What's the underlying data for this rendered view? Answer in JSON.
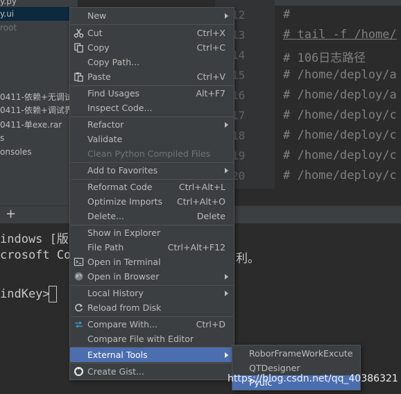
{
  "project_tree": {
    "rows": [
      {
        "text": "y.py"
      },
      {
        "text": "y.ui"
      },
      {
        "text": "root"
      },
      {
        "text": "0411-依赖+无调试"
      },
      {
        "text": "0411-依赖+调试界"
      },
      {
        "text": "0411-单exe.rar"
      },
      {
        "text": "s"
      },
      {
        "text": "onsoles"
      }
    ]
  },
  "editor": {
    "line_numbers": [
      "12",
      "13",
      "14",
      "15",
      "16",
      "17",
      "18",
      "19",
      "20"
    ],
    "lines": [
      "#",
      "# tail -f /home/",
      "# 106日志路径",
      "# /home/deploy/a",
      "# /home/deploy/a",
      "# /home/deploy/c",
      "# /home/deploy/c",
      "# /home/deploy/c",
      "# /home/deploy/c"
    ]
  },
  "terminal": {
    "plus": "+",
    "lines": [
      "indows [版",
      "crosoft Co",
      "利。",
      "indKey>"
    ]
  },
  "menu": {
    "items": [
      {
        "label": "New",
        "shortcut": "",
        "submenu": true
      },
      {
        "label": "Cut",
        "shortcut": "Ctrl+X",
        "icon": "scissors-icon"
      },
      {
        "label": "Copy",
        "shortcut": "Ctrl+C",
        "icon": "copy-icon"
      },
      {
        "label": "Copy Path...",
        "shortcut": ""
      },
      {
        "label": "Paste",
        "shortcut": "Ctrl+V",
        "icon": "paste-icon"
      },
      {
        "label": "Find Usages",
        "shortcut": "Alt+F7"
      },
      {
        "label": "Inspect Code...",
        "shortcut": ""
      },
      {
        "label": "Refactor",
        "shortcut": "",
        "submenu": true
      },
      {
        "label": "Validate",
        "shortcut": ""
      },
      {
        "label": "Clean Python Compiled Files",
        "shortcut": "",
        "disabled": true
      },
      {
        "label": "Add to Favorites",
        "shortcut": "",
        "submenu": true
      },
      {
        "label": "Reformat Code",
        "shortcut": "Ctrl+Alt+L"
      },
      {
        "label": "Optimize Imports",
        "shortcut": "Ctrl+Alt+O"
      },
      {
        "label": "Delete...",
        "shortcut": "Delete"
      },
      {
        "label": "Show in Explorer",
        "shortcut": ""
      },
      {
        "label": "File Path",
        "shortcut": "Ctrl+Alt+F12"
      },
      {
        "label": "Open in Terminal",
        "shortcut": "",
        "icon": "terminal-icon"
      },
      {
        "label": "Open in Browser",
        "shortcut": "",
        "icon": "globe-icon",
        "submenu": true
      },
      {
        "label": "Local History",
        "shortcut": "",
        "submenu": true
      },
      {
        "label": "Reload from Disk",
        "shortcut": "",
        "icon": "reload-icon"
      },
      {
        "label": "Compare With...",
        "shortcut": "Ctrl+D",
        "icon": "compare-icon"
      },
      {
        "label": "Compare File with Editor",
        "shortcut": ""
      },
      {
        "label": "External Tools",
        "shortcut": "",
        "submenu": true,
        "highlighted": true
      },
      {
        "label": "Create Gist...",
        "shortcut": "",
        "icon": "github-icon"
      }
    ]
  },
  "submenu": {
    "items": [
      {
        "label": "RoborFrameWorkExcute"
      },
      {
        "label": "QTDesigner"
      },
      {
        "label": "Pyuic"
      }
    ]
  },
  "watermark": "https://blog.csdn.net/qq_40386321",
  "colors": {
    "panel": "#3c3f41",
    "editor_bg": "#2b2b2b",
    "highlight": "#4b6eaf",
    "text": "#bbbbbb"
  }
}
